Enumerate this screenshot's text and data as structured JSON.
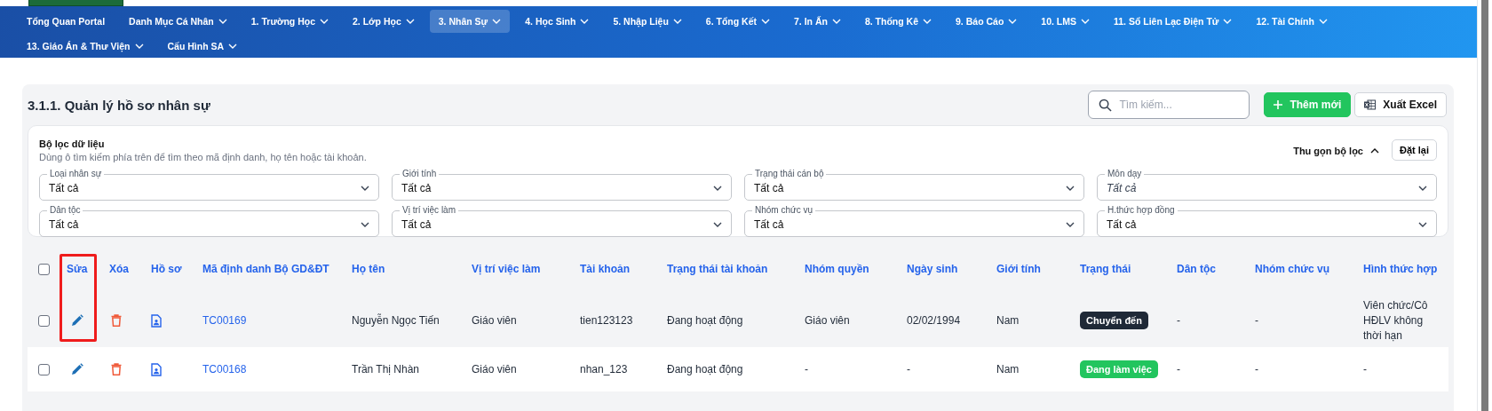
{
  "nav": {
    "items": [
      {
        "label": "Tổng Quan Portal",
        "dropdown": false,
        "selected": false
      },
      {
        "label": "Danh Mục Cá Nhân",
        "dropdown": true,
        "selected": false
      },
      {
        "label": "1. Trường Học",
        "dropdown": true,
        "selected": false
      },
      {
        "label": "2. Lớp Học",
        "dropdown": true,
        "selected": false
      },
      {
        "label": "3. Nhân Sự",
        "dropdown": true,
        "selected": true
      },
      {
        "label": "4. Học Sinh",
        "dropdown": true,
        "selected": false
      },
      {
        "label": "5. Nhập Liệu",
        "dropdown": true,
        "selected": false
      },
      {
        "label": "6. Tổng Kết",
        "dropdown": true,
        "selected": false
      },
      {
        "label": "7. In Ấn",
        "dropdown": true,
        "selected": false
      },
      {
        "label": "8. Thống Kê",
        "dropdown": true,
        "selected": false
      },
      {
        "label": "9. Báo Cáo",
        "dropdown": true,
        "selected": false
      },
      {
        "label": "10. LMS",
        "dropdown": true,
        "selected": false
      },
      {
        "label": "11. Sổ Liên Lạc Điện Tử",
        "dropdown": true,
        "selected": false
      },
      {
        "label": "12. Tài Chính",
        "dropdown": true,
        "selected": false
      },
      {
        "label": "13. Giáo Án & Thư Viện",
        "dropdown": true,
        "selected": false
      },
      {
        "label": "Cấu Hình SA",
        "dropdown": true,
        "selected": false
      }
    ]
  },
  "page": {
    "title": "3.1.1. Quản lý hồ sơ nhân sự",
    "search": {
      "placeholder": "Tìm kiếm..."
    },
    "buttons": [
      {
        "label": "Thêm mới",
        "kind": "add"
      },
      {
        "label": "Xuất Excel",
        "kind": "excel"
      }
    ]
  },
  "filters": {
    "title": "Bộ lọc dữ liệu",
    "hint": "Dùng ô tìm kiếm phía trên để tìm theo mã định danh, họ tên hoặc tài khoản.",
    "collapse_label": "Thu gọn bộ lọc",
    "reset_label": "Đặt lại",
    "fields": [
      {
        "label": "Loại nhân sự",
        "value": "Tất cả"
      },
      {
        "label": "Giới tính",
        "value": "Tất cả"
      },
      {
        "label": "Trạng thái cán bộ",
        "value": "Tất cả"
      },
      {
        "label": "Môn dạy",
        "placeholder": "Tất cả"
      },
      {
        "label": "Dân tộc",
        "value": "Tất cả"
      },
      {
        "label": "Vị trí việc làm",
        "value": "Tất cả"
      },
      {
        "label": "Nhóm chức vụ",
        "value": "Tất cả"
      },
      {
        "label": "H.thức hợp đồng",
        "value": "Tất cả"
      }
    ]
  },
  "table": {
    "header_checked": false,
    "columns": [
      {
        "label": "Sửa",
        "highlighted": true
      },
      {
        "label": "Xóa",
        "highlighted": false
      },
      {
        "label": "Hồ sơ",
        "highlighted": false
      },
      {
        "label": "Mã định danh Bộ GD&ĐT",
        "highlighted": false
      },
      {
        "label": "Họ tên",
        "highlighted": false
      },
      {
        "label": "Vị trí việc làm",
        "highlighted": false
      },
      {
        "label": "Tài khoản",
        "highlighted": false
      },
      {
        "label": "Trạng thái tài khoản",
        "highlighted": false
      },
      {
        "label": "Nhóm quyền",
        "highlighted": false
      },
      {
        "label": "Ngày sinh",
        "highlighted": false
      },
      {
        "label": "Giới tính",
        "highlighted": false
      },
      {
        "label": "Trạng thái",
        "highlighted": false
      },
      {
        "label": "Dân tộc",
        "highlighted": false
      },
      {
        "label": "Nhóm chức vụ",
        "highlighted": false
      },
      {
        "label": "Hình thức hợp",
        "highlighted": false
      }
    ],
    "rows": [
      {
        "checked": false,
        "code": "TC00169",
        "name": "Nguyễn Ngọc Tiến",
        "position": "Giáo viên",
        "account": "tien123123",
        "account_status": "Đang hoạt động",
        "role": "Giáo viên",
        "birthday": "02/02/1994",
        "gender": "Nam",
        "status": {
          "label": "Chuyển đến",
          "color": "#1f2937"
        },
        "ethnicity": "-",
        "title_group": "-",
        "contract": "Viên chức/Cô HĐLV không thời hạn"
      },
      {
        "checked": false,
        "code": "TC00168",
        "name": "Trần Thị Nhàn",
        "position": "Giáo viên",
        "account": "nhan_123",
        "account_status": "Đang hoạt động",
        "role": "-",
        "birthday": "-",
        "gender": "Nam",
        "status": {
          "label": "Đang làm việc",
          "color": "#22c55e"
        },
        "ethnicity": "-",
        "title_group": "-",
        "contract": "-"
      }
    ]
  }
}
